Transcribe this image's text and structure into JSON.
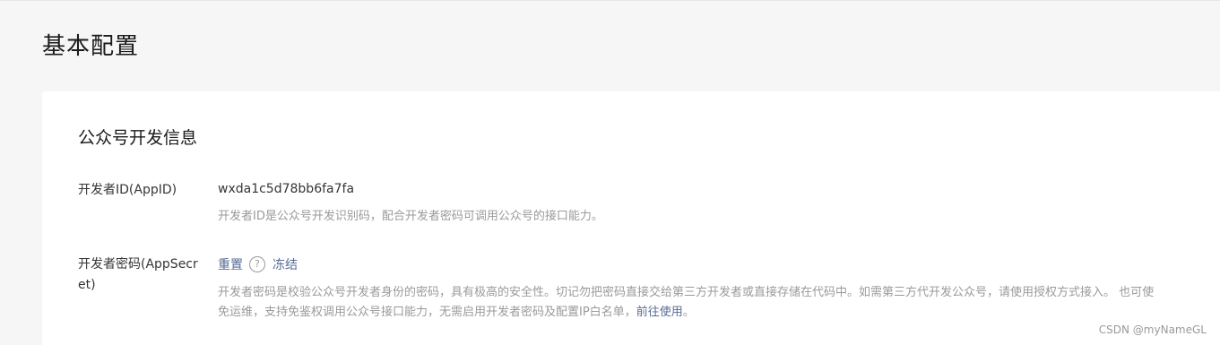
{
  "page": {
    "title": "基本配置"
  },
  "dev_info": {
    "title": "公众号开发信息",
    "appid": {
      "label": "开发者ID(AppID)",
      "value": "wxda1c5d78bb6fa7fa",
      "desc": "开发者ID是公众号开发识别码，配合开发者密码可调用公众号的接口能力。"
    },
    "appsecret": {
      "label": "开发者密码(AppSecret)",
      "reset_label": "重置",
      "help_icon_glyph": "?",
      "freeze_label": "冻结",
      "desc_line1": "开发者密码是校验公众号开发者身份的密码，具有极高的安全性。切记勿把密码直接交给第三方开发者或直接存储在代码中。如需第三方代开发公众号，请使用授权方式接入。 也可使",
      "desc_line2": "免运维，支持免鉴权调用公众号接口能力，无需启用开发者密码及配置IP白名单，",
      "desc_link": "前往使用",
      "desc_end": "。"
    }
  },
  "watermark": "CSDN @myNameGL",
  "colors": {
    "background": "#f6f6f7",
    "card": "#ffffff",
    "link": "#576b95",
    "muted_text": "#9a9a9a",
    "main_text": "#353535"
  }
}
